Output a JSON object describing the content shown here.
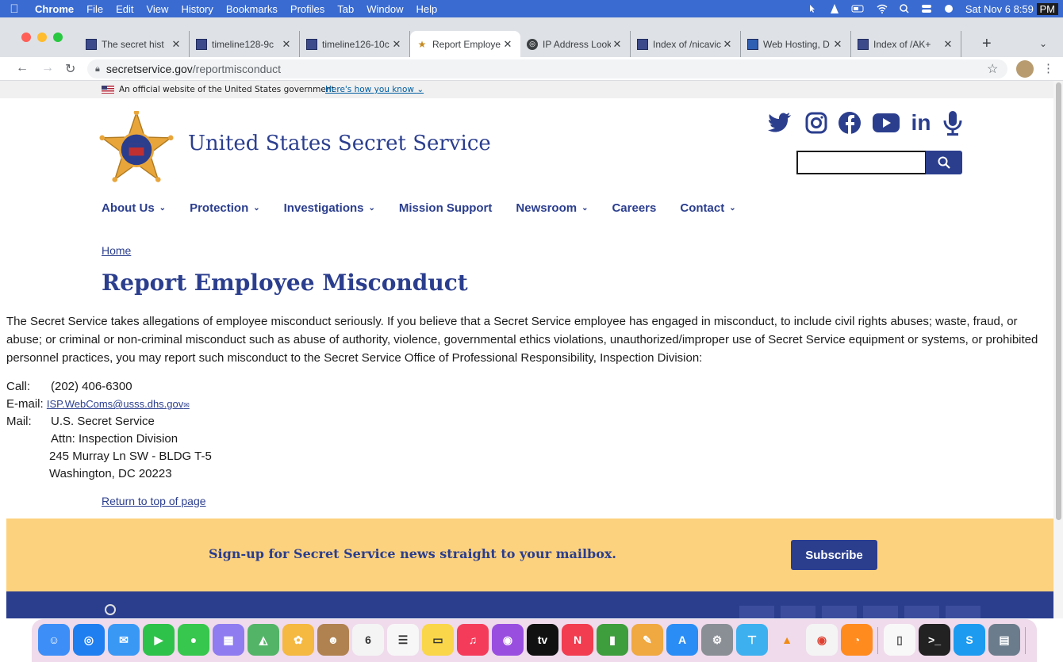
{
  "menubar": {
    "app": "Chrome",
    "items": [
      "File",
      "Edit",
      "View",
      "History",
      "Bookmarks",
      "Profiles",
      "Tab",
      "Window",
      "Help"
    ],
    "clock": "Sat Nov 6",
    "time": "8:59",
    "ampm": "PM"
  },
  "tabs": [
    {
      "label": "The secret hist",
      "icon": "grid-icon"
    },
    {
      "label": "timeline128-9c",
      "icon": "grid-icon"
    },
    {
      "label": "timeline126-10c",
      "icon": "grid-icon"
    },
    {
      "label": "Report Employe",
      "icon": "star-badge-icon"
    },
    {
      "label": "IP Address Look",
      "icon": "globe-icon"
    },
    {
      "label": "Index of /nicavic",
      "icon": "grid-icon"
    },
    {
      "label": "Web Hosting, D",
      "icon": "grid-icon"
    },
    {
      "label": "Index of /AK+",
      "icon": "grid-icon"
    }
  ],
  "address": {
    "domain": "secretservice.gov",
    "path": "/reportmisconduct"
  },
  "banner": {
    "official": "An official website of the United States government",
    "howknow": "Here's how you know"
  },
  "agency_name": "United States Secret Service",
  "nav": [
    {
      "label": "About Us",
      "dropdown": true
    },
    {
      "label": "Protection",
      "dropdown": true
    },
    {
      "label": "Investigations",
      "dropdown": true
    },
    {
      "label": "Mission Support",
      "dropdown": false
    },
    {
      "label": "Newsroom",
      "dropdown": true
    },
    {
      "label": "Careers",
      "dropdown": false
    },
    {
      "label": "Contact",
      "dropdown": true
    }
  ],
  "breadcrumb": "Home",
  "title": "Report Employee Misconduct",
  "intro": "The Secret Service takes allegations of employee misconduct seriously. If you believe that a Secret Service employee has engaged in misconduct, to include civil rights abuses; waste, fraud, or abuse; or criminal or non-criminal misconduct such as abuse of authority, violence, governmental ethics violations, unauthorized/improper use of Secret Service equipment or systems, or prohibited personnel practices, you may report such misconduct to the Secret Service Office of Professional Responsibility, Inspection Division:",
  "contact": {
    "call_label": "Call:",
    "call_value": "(202) 406-6300",
    "email_label": "E-mail:",
    "email_value": "ISP.WebComs@usss.dhs.gov",
    "mail_label": "Mail:",
    "mail_lines": [
      "U.S. Secret Service",
      "Attn: Inspection Division",
      "245 Murray Ln SW - BLDG T-5",
      "Washington, DC 20223"
    ]
  },
  "return_top": "Return to top of page",
  "signup": {
    "text": "Sign-up for Secret Service news straight to your mailbox.",
    "button": "Subscribe"
  },
  "colors": {
    "brand_blue": "#2b3e8e",
    "signup_bg": "#fdd27f",
    "menubar": "#3a6bd0"
  }
}
